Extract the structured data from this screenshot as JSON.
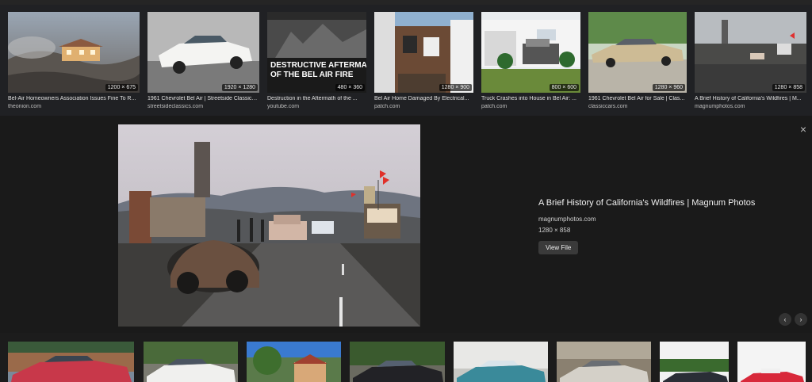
{
  "top_row": [
    {
      "title": "Bel-Air Homeowners Association Issues Fine To R...",
      "source": "theonion.com",
      "size": "1200 × 675"
    },
    {
      "title": "1961 Chevrolet Bel Air | Streetside Classics - The ...",
      "source": "streetsideclassics.com",
      "size": "1920 × 1280"
    },
    {
      "title": "Destruction in the Aftermath of the ...",
      "source": "youtube.com",
      "size": "480 × 360",
      "overlay_line1": "DESTRUCTIVE AFTERMATH",
      "overlay_line2": "OF THE BEL AIR FIRE"
    },
    {
      "title": "Bel Air Home Damaged By Electrical...",
      "source": "patch.com",
      "size": "1280 × 900"
    },
    {
      "title": "Truck Crashes into House in Bel Air: ...",
      "source": "patch.com",
      "size": "800 × 600"
    },
    {
      "title": "1961 Chevrolet Bel Air for Sale | Clas...",
      "source": "classiccars.com",
      "size": "1280 × 960"
    },
    {
      "title": "A Brief History of California's Wildfires | M...",
      "source": "magnumphotos.com",
      "size": "1280 × 858"
    }
  ],
  "preview": {
    "title": "A Brief History of California's Wildfires | Magnum Photos",
    "source": "magnumphotos.com",
    "size": "1280 × 858",
    "view_button": "View File",
    "close_icon": "×",
    "prev_icon": "‹",
    "next_icon": "›"
  },
  "bottom_row_count": 8
}
